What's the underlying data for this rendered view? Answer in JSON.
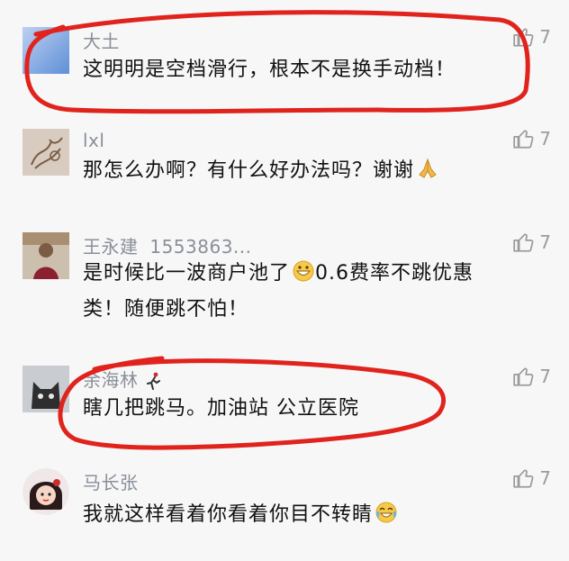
{
  "comments": [
    {
      "username": "大土",
      "text": "这明明是空档滑行，根本不是换手动档！",
      "likes": "7",
      "avatar": "blue-square-avatar"
    },
    {
      "username": "lxl",
      "text": "那怎么办啊？有什么好办法吗？谢谢",
      "likes": "7",
      "emoji": "praying-hands-icon",
      "avatar": "sketch-drawing-avatar"
    },
    {
      "username": "王永建",
      "username_suffix": "1553863...",
      "text_line1": "是时候比一波商户池了",
      "text_line1_b": "0.6费率不跳优惠",
      "text_line2": "类！随便跳不怕！",
      "likes": "7",
      "emoji": "grinning-face-icon",
      "avatar": "person-photo-avatar"
    },
    {
      "username": "余海林",
      "text": "瞎几把跳马。加油站 公立医院",
      "likes": "7",
      "badge": "running-figure-icon",
      "avatar": "cat-avatar"
    },
    {
      "username": "马长张",
      "text": "我就这样看着你看着你目不转睛",
      "likes": "7",
      "emoji": "tears-of-joy-icon",
      "avatar": "cartoon-girl-avatar"
    }
  ],
  "colors": {
    "background": "#f7f7f7",
    "username": "#8a8f99",
    "text": "#111111",
    "like": "#9b9b9b",
    "annotation": "#e0231c"
  }
}
